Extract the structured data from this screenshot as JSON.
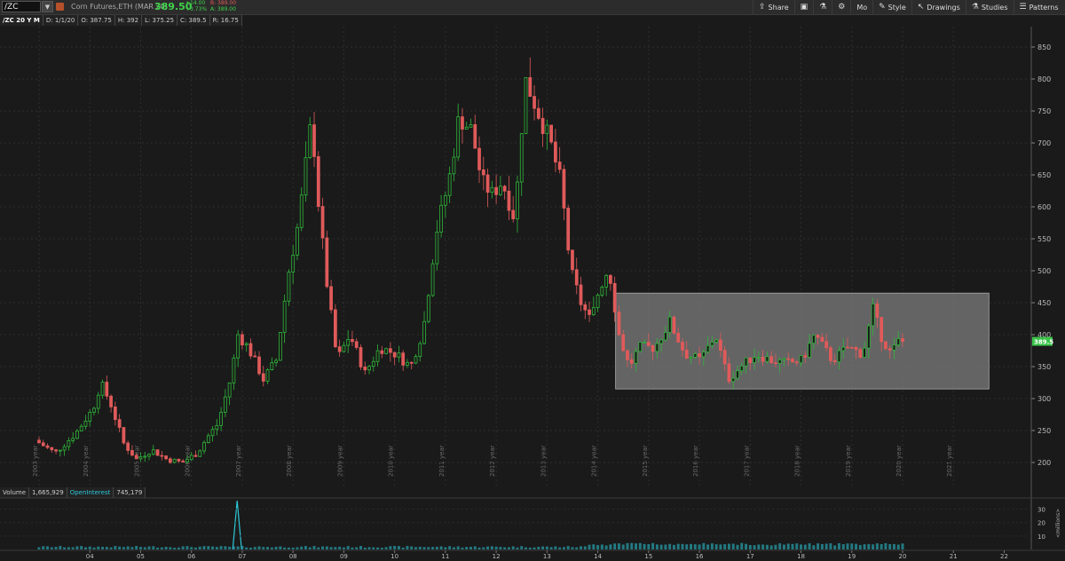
{
  "toolbar": {
    "symbol": "/ZC",
    "description": "Corn Futures,ETH (MAR 20)",
    "last_price": "389.50",
    "change": "+14.00",
    "change_pct": "+3.73%",
    "bid": "B: 389.00",
    "ask": "A: 389.00",
    "share_label": "Share",
    "mo_label": "Mo",
    "style_label": "Style",
    "drawings_label": "Drawings",
    "studies_label": "Studies",
    "patterns_label": "Patterns"
  },
  "info_bar": {
    "period": "/ZC 20 Y M",
    "date": "D: 1/1/20",
    "open": "O: 387.75",
    "high": "H: 392",
    "low": "L: 375.25",
    "close": "C: 389.5",
    "range": "R: 16.75"
  },
  "volume_bar": {
    "volume_label": "Volume",
    "volume_value": "1,665,929",
    "oi_label": "OpenInterest",
    "oi_value": "745,179"
  },
  "colors": {
    "up": "#2fb83a",
    "down": "#e05a5a",
    "background": "#1a1a1a",
    "highlight_box": "#7a7a7a",
    "last_price_tag": "#3ac44a",
    "volume": "#2cc8d8"
  },
  "chart_data": {
    "type": "candlestick",
    "y_ticks": [
      200,
      250,
      300,
      350,
      400,
      450,
      500,
      550,
      600,
      650,
      700,
      750,
      800,
      850
    ],
    "ylim": [
      185,
      865
    ],
    "x_period_labels": [
      "2003 year",
      "2004 year",
      "2005 year",
      "2006 year",
      "2007 year",
      "2008 year",
      "2009 year",
      "2010 year",
      "2011 year",
      "2012 year",
      "2013 year",
      "2014 year",
      "2015 year",
      "2016 year",
      "2017 year",
      "2018 year",
      "2019 year",
      "2020 year",
      "2021 year"
    ],
    "x_bottom_labels": [
      "04",
      "05",
      "06",
      "07",
      "08",
      "09",
      "10",
      "11",
      "12",
      "13",
      "14",
      "15",
      "16",
      "17",
      "18",
      "19",
      "20",
      "21",
      "22"
    ],
    "last_price_label": "389.5",
    "volume_axis_ticks": [
      10,
      20,
      30
    ],
    "volume_axis_label": "<millions>",
    "highlight_range": {
      "x_start": 2014.35,
      "x_end": 2021.7,
      "y_low": 315,
      "y_high": 465
    },
    "anchors_year_price": [
      [
        2003.0,
        235
      ],
      [
        2003.4,
        215
      ],
      [
        2003.8,
        245
      ],
      [
        2004.15,
        285
      ],
      [
        2004.3,
        325
      ],
      [
        2004.5,
        290
      ],
      [
        2004.75,
        230
      ],
      [
        2005.0,
        205
      ],
      [
        2005.3,
        220
      ],
      [
        2005.6,
        205
      ],
      [
        2005.9,
        200
      ],
      [
        2006.2,
        215
      ],
      [
        2006.4,
        240
      ],
      [
        2006.6,
        260
      ],
      [
        2006.85,
        330
      ],
      [
        2007.0,
        400
      ],
      [
        2007.2,
        380
      ],
      [
        2007.5,
        330
      ],
      [
        2007.75,
        360
      ],
      [
        2008.0,
        500
      ],
      [
        2008.2,
        580
      ],
      [
        2008.45,
        740
      ],
      [
        2008.6,
        590
      ],
      [
        2008.75,
        480
      ],
      [
        2008.95,
        360
      ],
      [
        2009.2,
        400
      ],
      [
        2009.5,
        340
      ],
      [
        2009.8,
        380
      ],
      [
        2010.1,
        370
      ],
      [
        2010.4,
        350
      ],
      [
        2010.65,
        410
      ],
      [
        2010.9,
        560
      ],
      [
        2011.15,
        640
      ],
      [
        2011.35,
        740
      ],
      [
        2011.6,
        720
      ],
      [
        2011.8,
        640
      ],
      [
        2012.0,
        620
      ],
      [
        2012.2,
        640
      ],
      [
        2012.45,
        580
      ],
      [
        2012.65,
        800
      ],
      [
        2012.9,
        750
      ],
      [
        2013.15,
        700
      ],
      [
        2013.35,
        640
      ],
      [
        2013.55,
        500
      ],
      [
        2013.75,
        450
      ],
      [
        2013.95,
        420
      ],
      [
        2014.1,
        470
      ],
      [
        2014.3,
        505
      ],
      [
        2014.5,
        400
      ],
      [
        2014.7,
        350
      ],
      [
        2014.9,
        380
      ],
      [
        2015.2,
        380
      ],
      [
        2015.5,
        420
      ],
      [
        2015.8,
        370
      ],
      [
        2016.1,
        360
      ],
      [
        2016.4,
        400
      ],
      [
        2016.65,
        330
      ],
      [
        2016.9,
        350
      ],
      [
        2017.2,
        370
      ],
      [
        2017.5,
        360
      ],
      [
        2017.8,
        355
      ],
      [
        2018.1,
        360
      ],
      [
        2018.35,
        400
      ],
      [
        2018.7,
        360
      ],
      [
        2019.0,
        380
      ],
      [
        2019.3,
        370
      ],
      [
        2019.5,
        440
      ],
      [
        2019.65,
        400
      ],
      [
        2019.85,
        370
      ],
      [
        2020.0,
        389.5
      ]
    ]
  }
}
